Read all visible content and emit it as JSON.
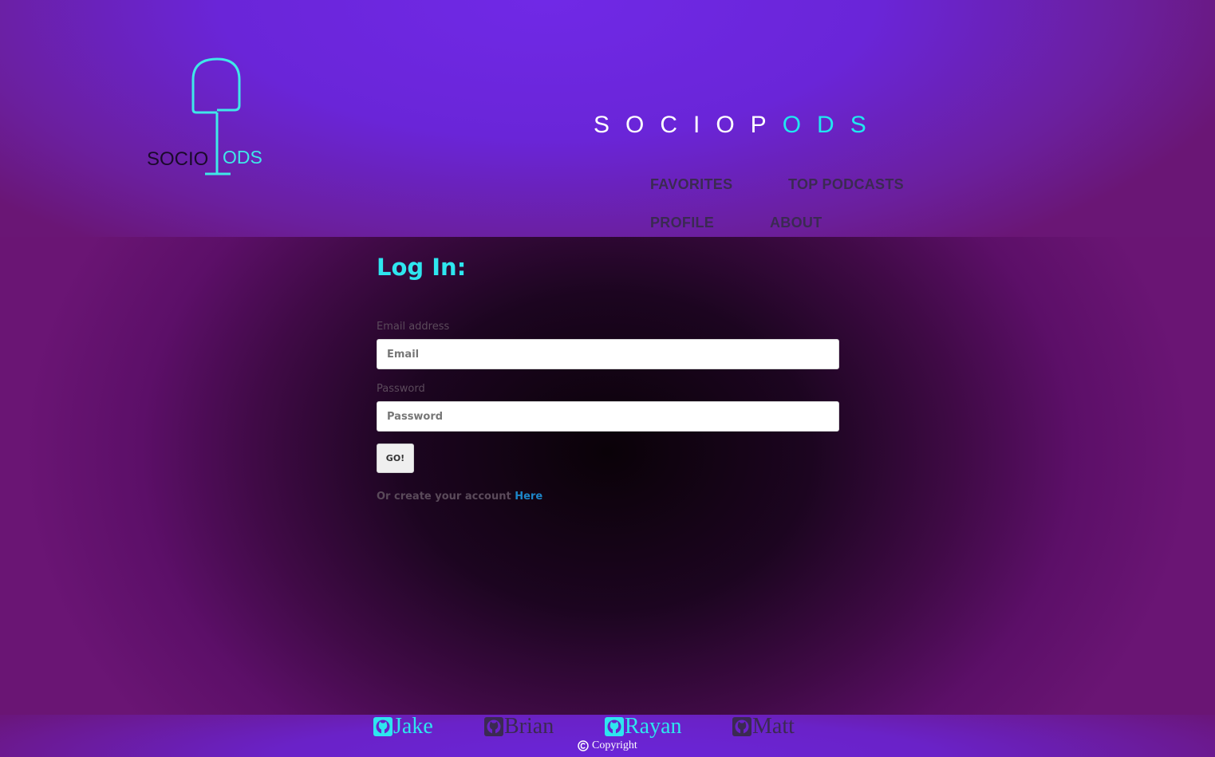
{
  "header": {
    "logo": {
      "word_left": "SOCIO",
      "word_right": "ODS",
      "colors": {
        "outline": "#3fe8e8",
        "left_text": "#1a0a2a"
      }
    },
    "brand_title_part1": "SOCIOP",
    "brand_title_part2": "ODS",
    "nav": {
      "favorites": "FAVORITES",
      "top_podcasts": "TOP PODCASTS",
      "profile": "PROFILE",
      "about": "ABOUT"
    }
  },
  "login": {
    "title": "Log In:",
    "email_label": "Email address",
    "email_placeholder": "Email",
    "email_value": "",
    "password_label": "Password",
    "password_placeholder": "Password",
    "password_value": "",
    "submit_label": "GO!",
    "create_text": "Or create your account",
    "create_link": "Here"
  },
  "footer": {
    "links": [
      {
        "name": "Jake",
        "icon": "github-icon",
        "color": "#2ee6ef"
      },
      {
        "name": "Brian",
        "icon": "github-icon",
        "color": "#3b2a52"
      },
      {
        "name": "Rayan",
        "icon": "github-icon",
        "color": "#2ee6ef"
      },
      {
        "name": "Matt",
        "icon": "github-icon",
        "color": "#3b2a52"
      }
    ],
    "copyright": "Copyright",
    "copyright_icon": "copyright-icon"
  },
  "colors": {
    "accent_cyan": "#2ee6ef",
    "header_purple": "#7029e6",
    "link_blue": "#1d86c8"
  }
}
